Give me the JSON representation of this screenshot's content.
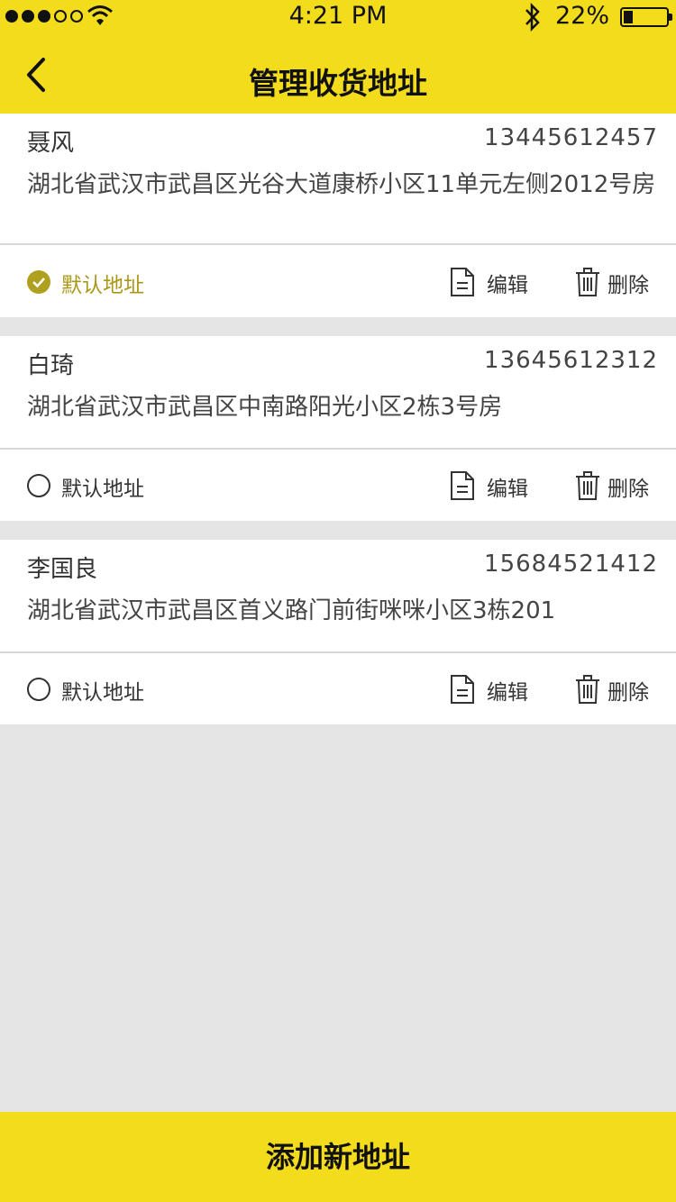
{
  "status_bar": {
    "time": "4:21 PM",
    "battery": "22%",
    "signal_icon": "signal-dots-icon",
    "wifi_icon": "wifi-icon",
    "bluetooth_icon": "bluetooth-icon",
    "battery_level": 0.22
  },
  "header": {
    "title": "管理收货地址",
    "back_icon": "chevron-left-icon"
  },
  "addresses": [
    {
      "name": "聂风",
      "phone": "13445612457",
      "address": "湖北省武汉市武昌区光谷大道康桥小区11单元左侧2012号房",
      "default_label": "默认地址",
      "is_default": true,
      "edit_label": "编辑",
      "delete_label": "删除"
    },
    {
      "name": "白琦",
      "phone": "13645612312",
      "address": "湖北省武汉市武昌区中南路阳光小区2栋3号房",
      "default_label": "默认地址",
      "is_default": false,
      "edit_label": "编辑",
      "delete_label": "删除"
    },
    {
      "name": "李国良",
      "phone": "15684521412",
      "address": "湖北省武汉市武昌区首义路门前街咪咪小区3栋201",
      "default_label": "默认地址",
      "is_default": false,
      "edit_label": "编辑",
      "delete_label": "删除"
    }
  ],
  "footer": {
    "add_button": "添加新地址"
  },
  "colors": {
    "brand_yellow": "#f2dc1c",
    "default_accent": "#b0a020",
    "page_background": "#e5e5e5"
  }
}
